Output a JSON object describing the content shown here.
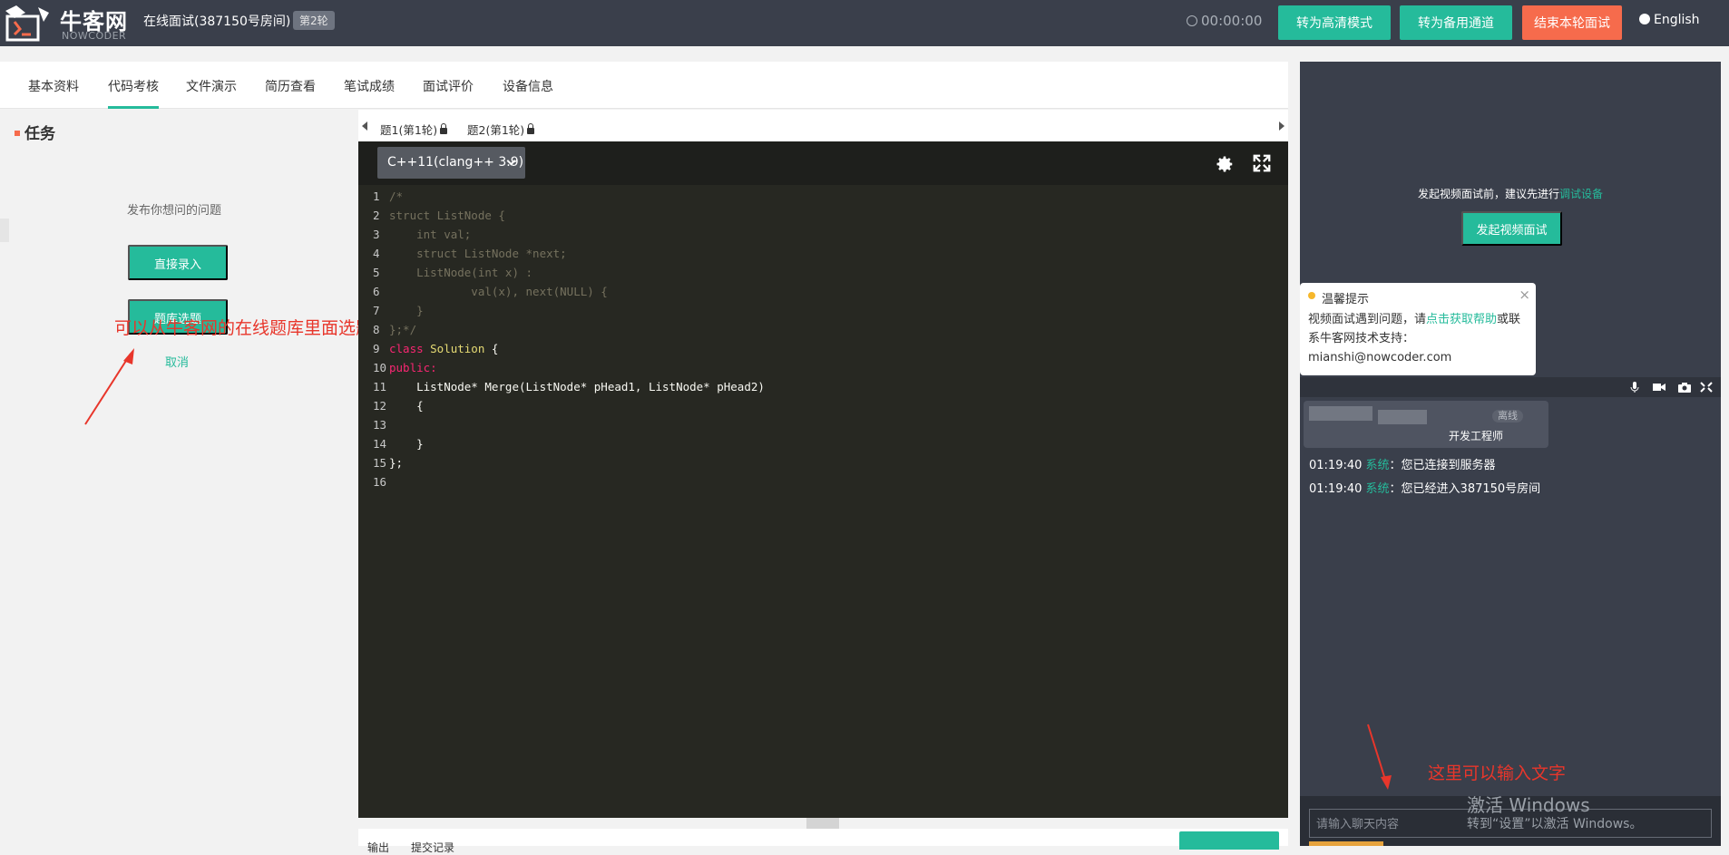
{
  "header": {
    "logo_cn": "牛客网",
    "logo_en": "NOWCODER",
    "room_title": "在线面试(387150号房间)",
    "round_badge": "第2轮",
    "timer": "00:00:00",
    "buttons": {
      "hd_mode": "转为高清模式",
      "backup_channel": "转为备用通道",
      "end_interview": "结束本轮面试"
    },
    "language": "English"
  },
  "tabs": [
    "基本资料",
    "代码考核",
    "文件演示",
    "简历查看",
    "笔试成绩",
    "面试评价",
    "设备信息"
  ],
  "active_tab": "代码考核",
  "task": {
    "title": "任务",
    "hint": "发布你想问的问题",
    "direct_entry": "直接录入",
    "select_from_bank": "题库选题",
    "cancel": "取消",
    "annotation": "可以从牛客网的在线题库里面选题"
  },
  "editor": {
    "question_tabs": [
      {
        "label": "题1(第1轮)",
        "locked": true
      },
      {
        "label": "题2(第1轮)",
        "locked": true
      }
    ],
    "language": "C++11(clang++ 3.9)",
    "code_lines": [
      "/*",
      "struct ListNode {",
      "    int val;",
      "    struct ListNode *next;",
      "    ListNode(int x) :",
      "            val(x), next(NULL) {",
      "    }",
      "};*/",
      "class Solution {",
      "public:",
      "    ListNode* Merge(ListNode* pHead1, ListNode* pHead2)",
      "    {",
      "        ",
      "    }",
      "};",
      ""
    ],
    "bottom_tabs": [
      "输出",
      "提交记录"
    ]
  },
  "video": {
    "hint_prefix": "发起视频面试前，建议先进行",
    "hint_link": "调试设备",
    "start_button": "发起视频面试",
    "tip": {
      "title": "温馨提示",
      "body_prefix": "视频面试遇到问题，请",
      "body_link": "点击获取帮助",
      "body_mid": "或联系牛客网技术支持：",
      "email": "mianshi@nowcoder.com"
    }
  },
  "participant": {
    "status": "离线",
    "role": "开发工程师"
  },
  "chat": {
    "messages": [
      {
        "time": "01:19:40",
        "sender": "系统",
        "text": "：您已连接到服务器"
      },
      {
        "time": "01:19:40",
        "sender": "系统",
        "text": "：您已经进入387150号房间"
      }
    ],
    "input_placeholder": "请输入聊天内容",
    "annotation": "这里可以输入文字"
  },
  "watermark": {
    "title": "激活 Windows",
    "sub": "转到“设置”以激活 Windows。"
  },
  "colors": {
    "brand_green": "#25bb9b",
    "danger_orange": "#f66b4c",
    "header_bg": "#3a3f4b",
    "code_bg": "#272822",
    "annotation_red": "#e8362b"
  }
}
